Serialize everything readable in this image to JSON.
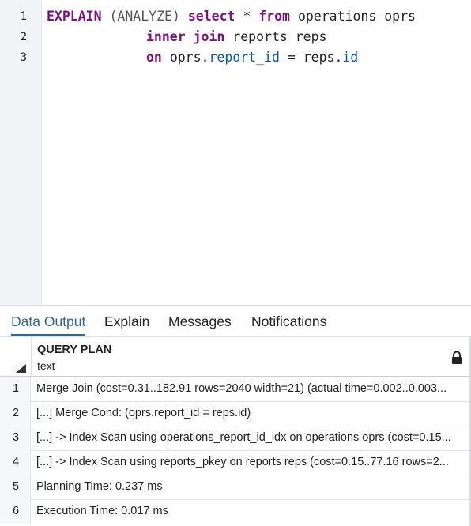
{
  "editor": {
    "line_numbers": [
      "1",
      "2",
      "3"
    ],
    "lines": [
      {
        "kw1": "EXPLAIN",
        "paren": "(ANALYZE)",
        "kw2": "select",
        "star": "*",
        "kw3": "from",
        "rest": "operations oprs"
      },
      {
        "kw1": "inner join",
        "rest": "reports reps"
      },
      {
        "kw1": "on",
        "prefix": "oprs.",
        "col1": "report_id",
        "eq": "=",
        "prefix2": "reps.",
        "col2": "id"
      }
    ]
  },
  "tabs": [
    {
      "label": "Data Output",
      "active": true
    },
    {
      "label": "Explain",
      "active": false
    },
    {
      "label": "Messages",
      "active": false
    },
    {
      "label": "Notifications",
      "active": false
    }
  ],
  "grid": {
    "column": {
      "name": "QUERY PLAN",
      "type": "text",
      "locked_icon": "lock-icon"
    },
    "rows": [
      {
        "num": "1",
        "value": "Merge Join  (cost=0.31..182.91 rows=2040 width=21) (actual time=0.002..0.003..."
      },
      {
        "num": "2",
        "value": "[...] Merge Cond: (oprs.report_id = reps.id)"
      },
      {
        "num": "3",
        "value": "[...] ->  Index Scan using operations_report_id_idx on operations oprs  (cost=0.15..."
      },
      {
        "num": "4",
        "value": "[...] ->  Index Scan using reports_pkey on reports reps  (cost=0.15..77.16 rows=2..."
      },
      {
        "num": "5",
        "value": "Planning Time: 0.237 ms"
      },
      {
        "num": "6",
        "value": "Execution Time: 0.017 ms"
      }
    ]
  },
  "colors": {
    "keyword": "#7a0f7f",
    "column": "#0a56a8",
    "active_tab": "#326690"
  }
}
